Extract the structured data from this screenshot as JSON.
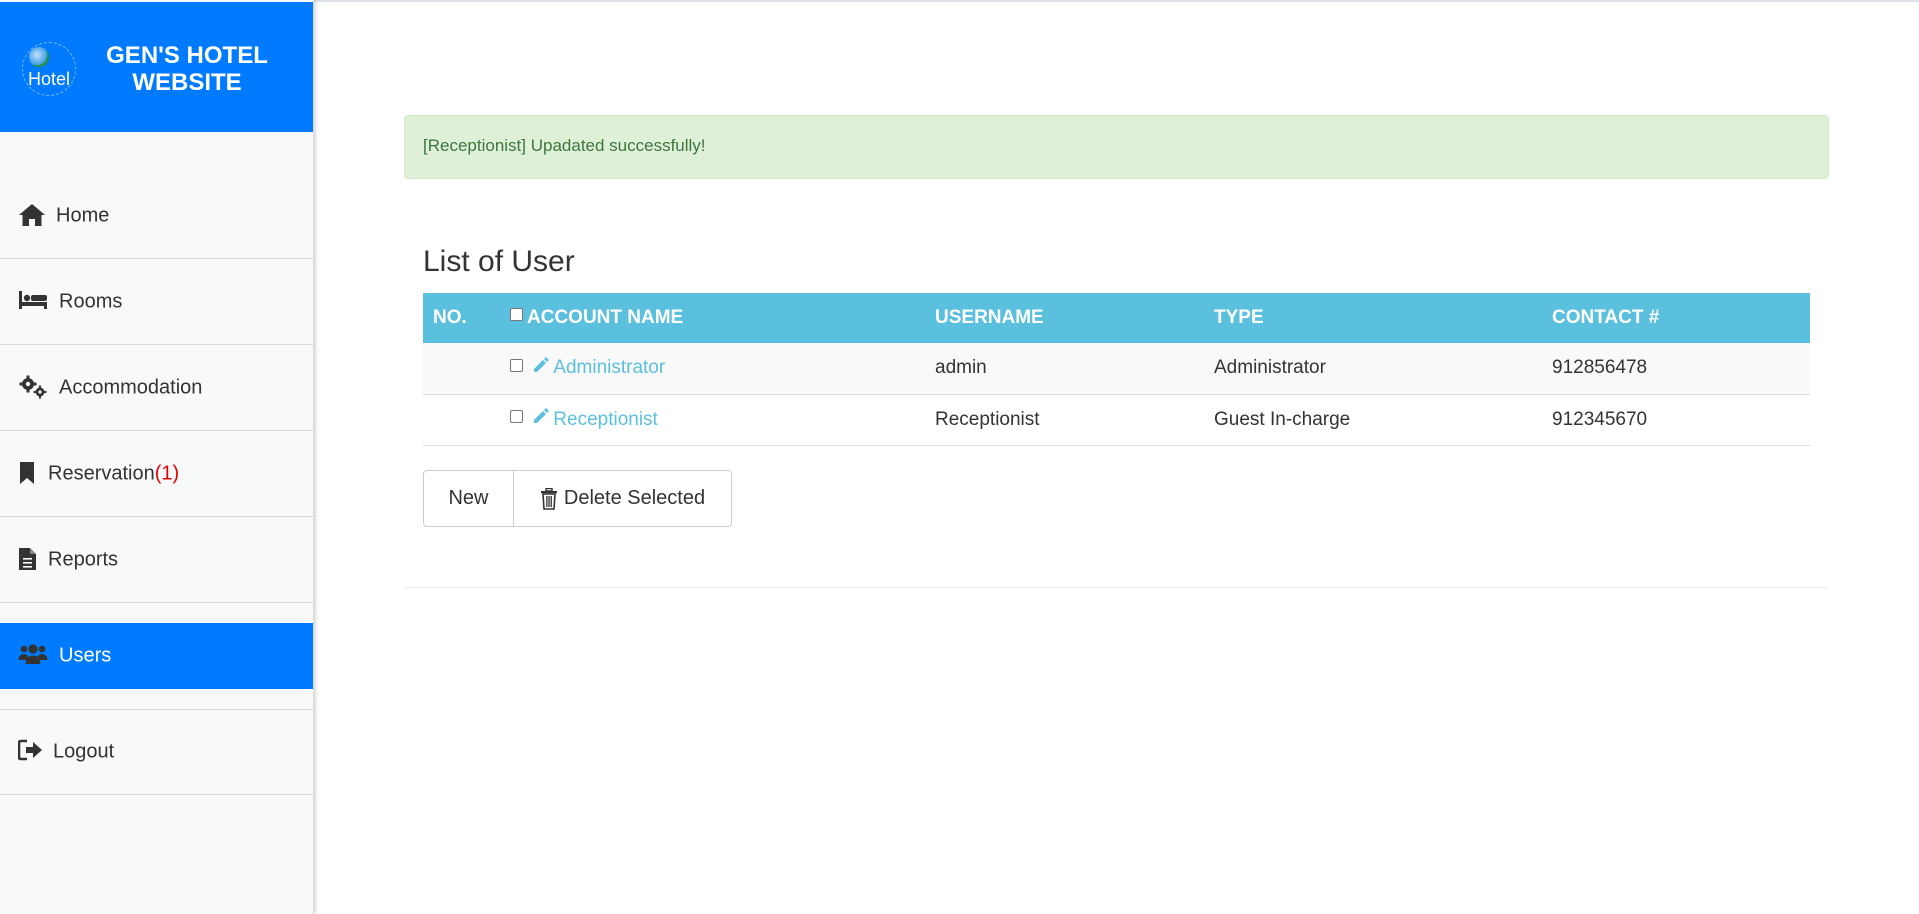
{
  "brand": {
    "logo_text": "Hotel",
    "title": "GEN'S HOTEL WEBSITE",
    "color": "#007bff"
  },
  "nav": [
    {
      "label": "Home",
      "icon": "home-icon"
    },
    {
      "label": "Rooms",
      "icon": "bed-icon"
    },
    {
      "label": "Accommodation",
      "icon": "gears-icon"
    },
    {
      "label": "Reservation",
      "badge": "(1)",
      "icon": "bookmark-icon"
    },
    {
      "label": "Reports",
      "icon": "file-icon"
    },
    {
      "label": "Users",
      "icon": "users-icon",
      "active": true
    },
    {
      "label": "Logout",
      "icon": "sign-out-icon"
    }
  ],
  "alert": {
    "message": "[Receptionist] Upadated successfully!",
    "color": "#3c763d"
  },
  "list": {
    "title": "List of User",
    "columns": [
      "NO.",
      "ACCOUNT NAME",
      "USERNAME",
      "TYPE",
      "CONTACT #"
    ],
    "rows": [
      {
        "no": "",
        "account_name": "Administrator",
        "username": "admin",
        "type": "Administrator",
        "contact": "912856478"
      },
      {
        "no": "",
        "account_name": "Receptionist",
        "username": "Receptionist",
        "type": "Guest In-charge",
        "contact": "912345670"
      }
    ],
    "header_color": "#5bc0de"
  },
  "actions": {
    "new_label": "New",
    "delete_label": "Delete Selected"
  }
}
